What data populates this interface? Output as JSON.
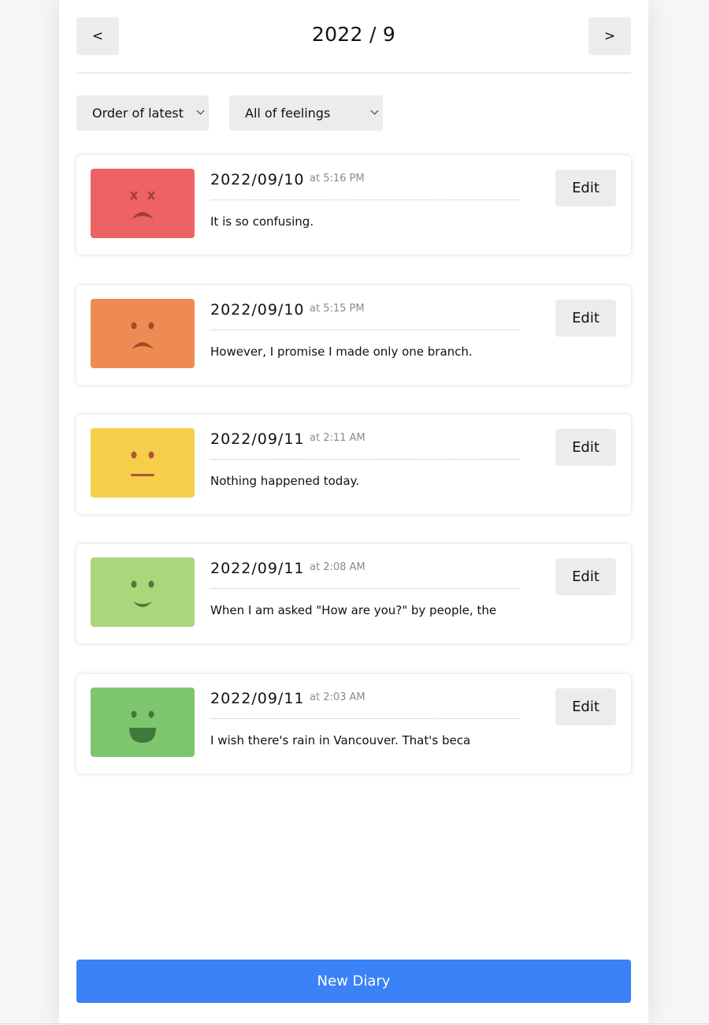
{
  "header": {
    "title": "2022 / 9",
    "prev_label": "<",
    "next_label": ">"
  },
  "filters": {
    "order_selected": "Order of latest",
    "feeling_selected": "All of feelings"
  },
  "entries": [
    {
      "date": "2022/09/10",
      "time": "at 5:16 PM",
      "content": "It is so confusing.",
      "emotion": "terrible",
      "emotion_color": "#ec6265",
      "face_color": "#a33c3c",
      "edit_label": "Edit"
    },
    {
      "date": "2022/09/10",
      "time": "at 5:15 PM",
      "content": "However, I promise I made only one branch.",
      "emotion": "bad",
      "emotion_color": "#ee8b53",
      "face_color": "#a8492a",
      "edit_label": "Edit"
    },
    {
      "date": "2022/09/11",
      "time": "at 2:11 AM",
      "content": "Nothing happened today.",
      "emotion": "normal",
      "emotion_color": "#f5cf4a",
      "face_color": "#b0553a",
      "edit_label": "Edit"
    },
    {
      "date": "2022/09/11",
      "time": "at 2:08 AM",
      "content": "When I am asked \"How are you?\" by people, the",
      "emotion": "good",
      "emotion_color": "#abd67b",
      "face_color": "#4f7a3e",
      "edit_label": "Edit"
    },
    {
      "date": "2022/09/11",
      "time": "at 2:03 AM",
      "content": "I wish there's rain in Vancouver. That's beca",
      "emotion": "great",
      "emotion_color": "#7dc66e",
      "face_color": "#3f7a3a",
      "edit_label": "Edit"
    }
  ],
  "new_diary_label": "New Diary"
}
